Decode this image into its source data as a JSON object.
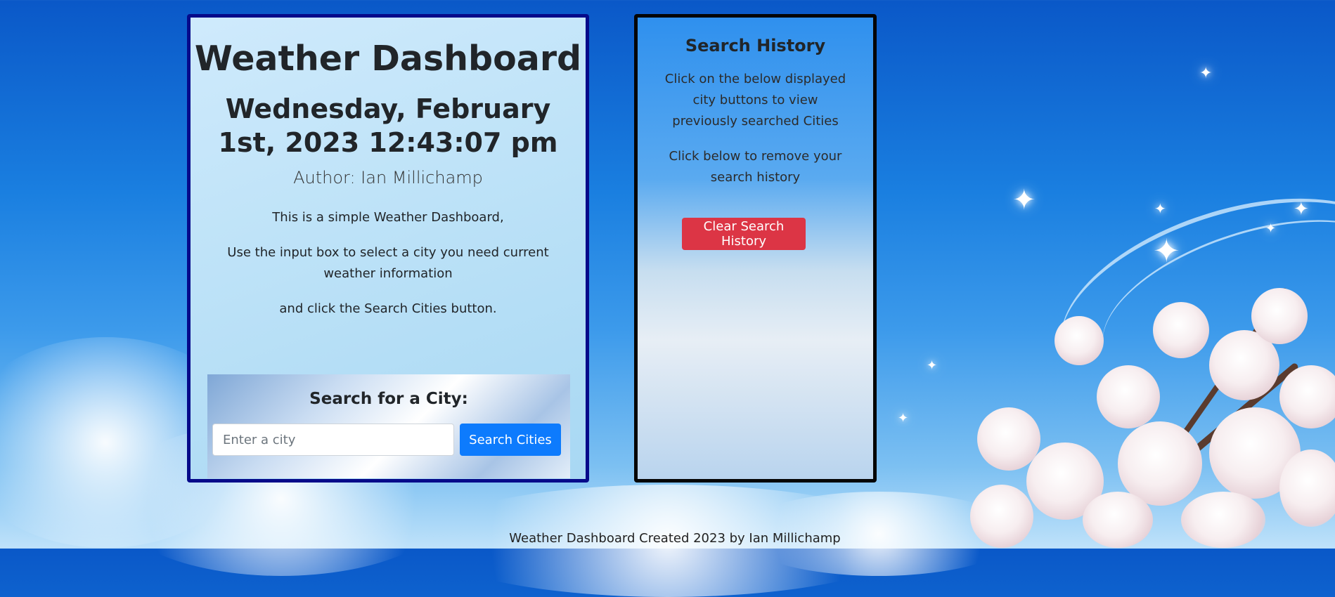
{
  "app": {
    "title": "Weather Dashboard",
    "datetime": "Wednesday, February 1st, 2023 12:43:07 pm",
    "author": "Author: Ian Millichamp",
    "intro": "This is a simple Weather Dashboard,",
    "instructions": "Use the input box to select a city you need current weather information",
    "instructions2": "and click the Search Cities button."
  },
  "search": {
    "heading": "Search for a City:",
    "placeholder": "Enter a city",
    "value": "",
    "button_label": "Search Cities"
  },
  "history": {
    "heading": "Search History",
    "description": "Click on the below displayed city buttons to view previously searched Cities",
    "remove_note": "Click below to remove your search history",
    "clear_button_label": "Clear Search History",
    "cities": []
  },
  "footer": {
    "text": "Weather Dashboard Created 2023 by Ian Millichamp"
  },
  "colors": {
    "primary_button": "#0d7bfd",
    "danger_button": "#dc3545",
    "left_card_border": "#060a8a",
    "right_card_border": "#050505"
  },
  "icons": {
    "background_decoration": "sparkle-icon"
  }
}
